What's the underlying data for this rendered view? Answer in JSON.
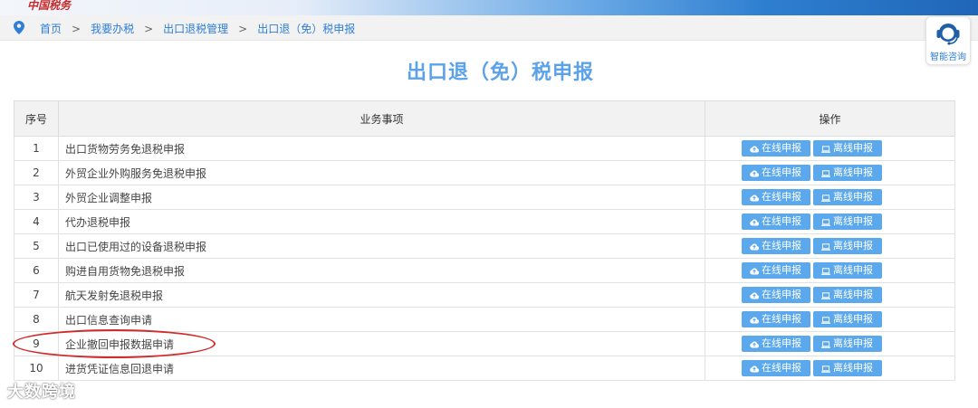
{
  "brand": "中国税务",
  "breadcrumb": {
    "items": [
      "首页",
      "我要办税",
      "出口退税管理",
      "出口退（免）税申报"
    ],
    "separator": ">"
  },
  "consult": {
    "label": "智能咨询",
    "icon": "headset-icon"
  },
  "page": {
    "title": "出口退（免）税申报"
  },
  "table": {
    "headers": {
      "no": "序号",
      "item": "业务事项",
      "ops": "操作"
    },
    "rows": [
      {
        "no": "1",
        "item": "出口货物劳务免退税申报"
      },
      {
        "no": "2",
        "item": "外贸企业外购服务免退税申报"
      },
      {
        "no": "3",
        "item": "外贸企业调整申报"
      },
      {
        "no": "4",
        "item": "代办退税申报"
      },
      {
        "no": "5",
        "item": "出口已使用过的设备退税申报"
      },
      {
        "no": "6",
        "item": "购进自用货物免退税申报"
      },
      {
        "no": "7",
        "item": "航天发射免退税申报"
      },
      {
        "no": "8",
        "item": "出口信息查询申请"
      },
      {
        "no": "9",
        "item": "企业撤回申报数据申请"
      },
      {
        "no": "10",
        "item": "进货凭证信息回退申请"
      }
    ],
    "online_label": "在线申报",
    "offline_label": "离线申报"
  },
  "annotation": {
    "highlighted_row": "9"
  },
  "watermark": "大数跨境",
  "colors": {
    "accent": "#5ba8ec",
    "title": "#5ba2e8",
    "link": "#2f7ed8",
    "annotation": "#d22b2b"
  }
}
